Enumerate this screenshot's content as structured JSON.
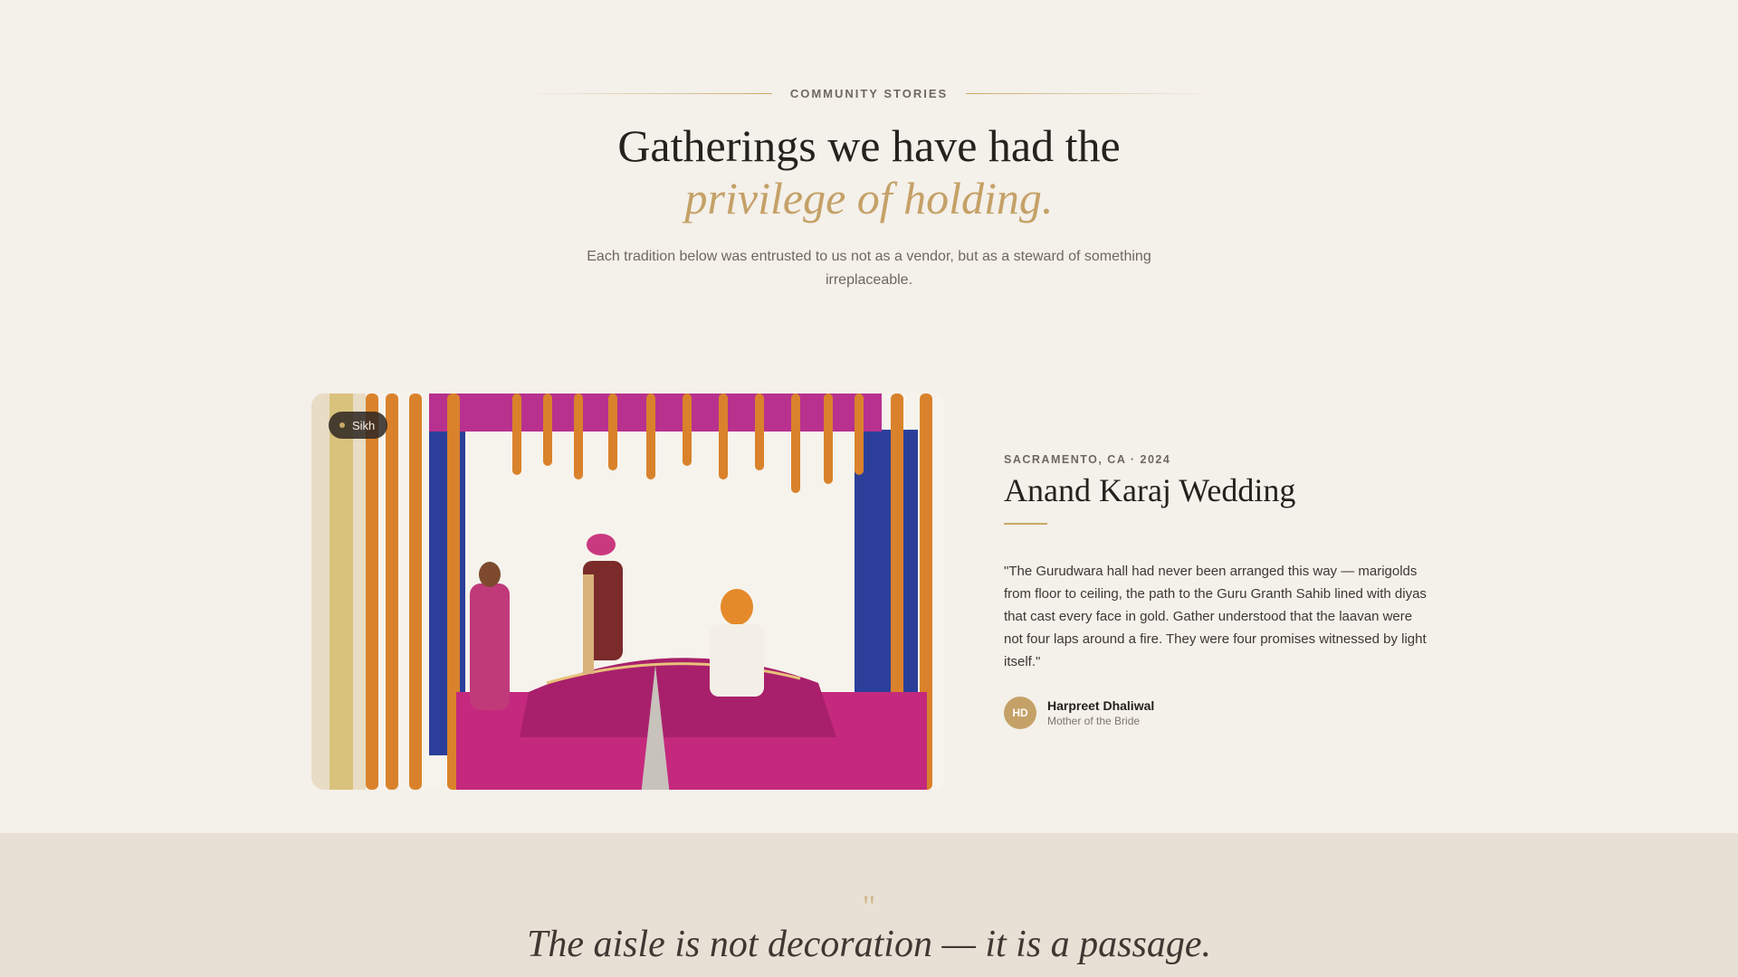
{
  "section": {
    "eyebrow": "COMMUNITY STORIES",
    "headline_line1": "Gatherings we have had the",
    "headline_accent": "privilege of holding.",
    "subtext": "Each tradition below was entrusted to us not as a vendor, but as a steward of something irreplaceable."
  },
  "story": {
    "tag": "Sikh",
    "meta": "SACRAMENTO, CA · 2024",
    "title": "Anand Karaj Wedding",
    "quote": "\"The Gurudwara hall had never been arranged this way — marigolds from floor to ceiling, the path to the Guru Granth Sahib lined with diyas that cast every face in gold. Gather understood that the laavan were not four laps around a fire. They were four promises witnessed by light itself.\"",
    "author_initials": "HD",
    "author_name": "Harpreet Dhaliwal",
    "author_role": "Mother of the Bride"
  },
  "banner": {
    "quote_mark": "\"",
    "quote": "The aisle is not decoration — it is a passage."
  },
  "colors": {
    "background": "#f4f0ea",
    "accent_gold": "#c4a167",
    "band": "#e9e0d5",
    "text_dark": "#25211d"
  }
}
